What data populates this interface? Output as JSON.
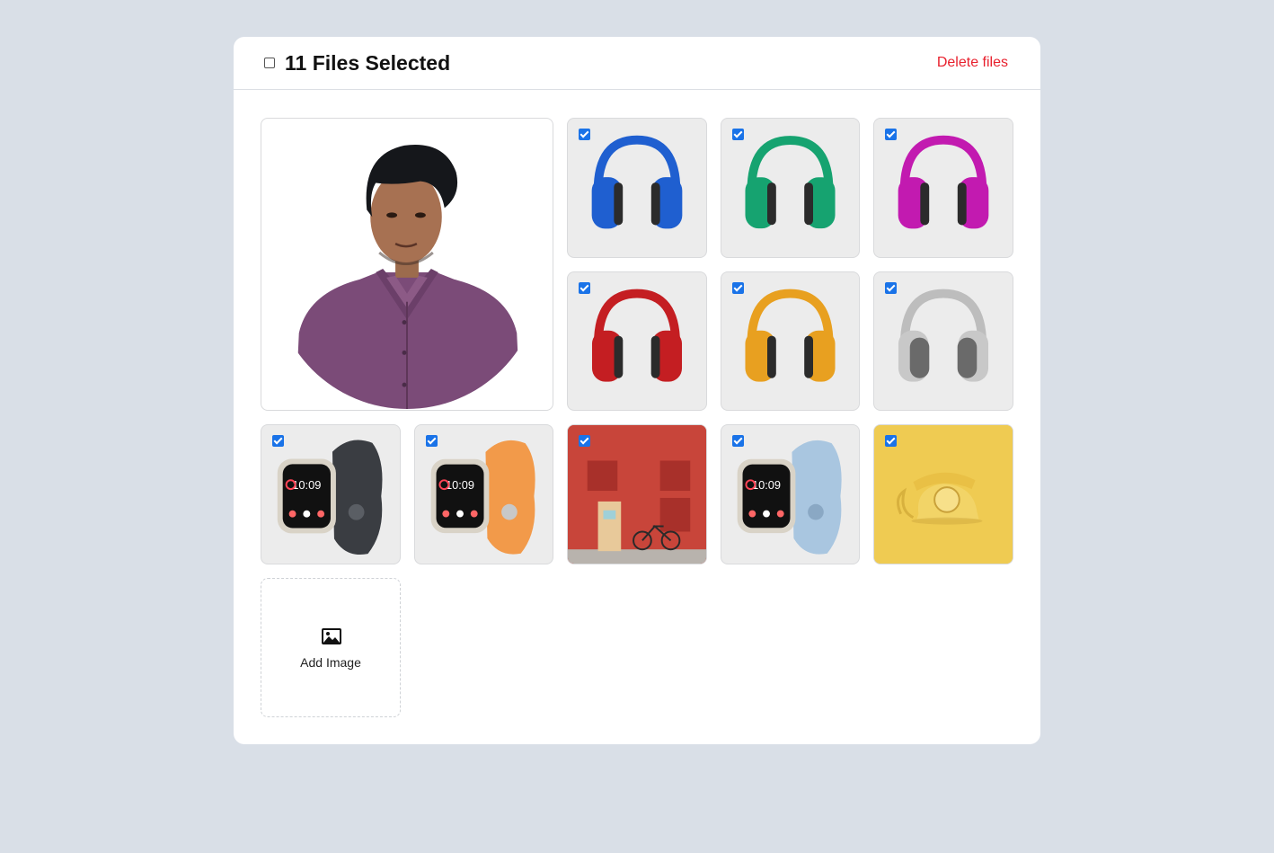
{
  "header": {
    "title": "11 Files Selected",
    "delete_label": "Delete files"
  },
  "gallery": {
    "items": [
      {
        "subject": "portrait of a man in a purple shirt",
        "selected": false
      },
      {
        "subject": "blue headphones",
        "color": "#1f5fd0",
        "selected": true
      },
      {
        "subject": "green headphones",
        "color": "#16a370",
        "selected": true
      },
      {
        "subject": "magenta headphones",
        "color": "#c21ab0",
        "selected": true
      },
      {
        "subject": "red headphones",
        "color": "#c41e22",
        "selected": true
      },
      {
        "subject": "orange headphones",
        "color": "#e8a020",
        "selected": true
      },
      {
        "subject": "gray headphones",
        "color": "#8a8a8a",
        "selected": true
      },
      {
        "subject": "smartwatch with dark band",
        "color": "#3a3d42",
        "selected": true
      },
      {
        "subject": "smartwatch with orange band",
        "color": "#f29a4a",
        "selected": true
      },
      {
        "subject": "red brick wall with door and bicycle",
        "selected": true
      },
      {
        "subject": "smartwatch with light blue band",
        "color": "#a9c6e0",
        "selected": true
      },
      {
        "subject": "yellow rotary telephone",
        "color": "#efcb52",
        "selected": true
      }
    ],
    "add_label": "Add Image"
  },
  "watch_face": {
    "time": "10:09"
  },
  "colors": {
    "background": "#d9dfe7",
    "accent_delete": "#e8202d",
    "checkbox": "#1a73e8"
  }
}
